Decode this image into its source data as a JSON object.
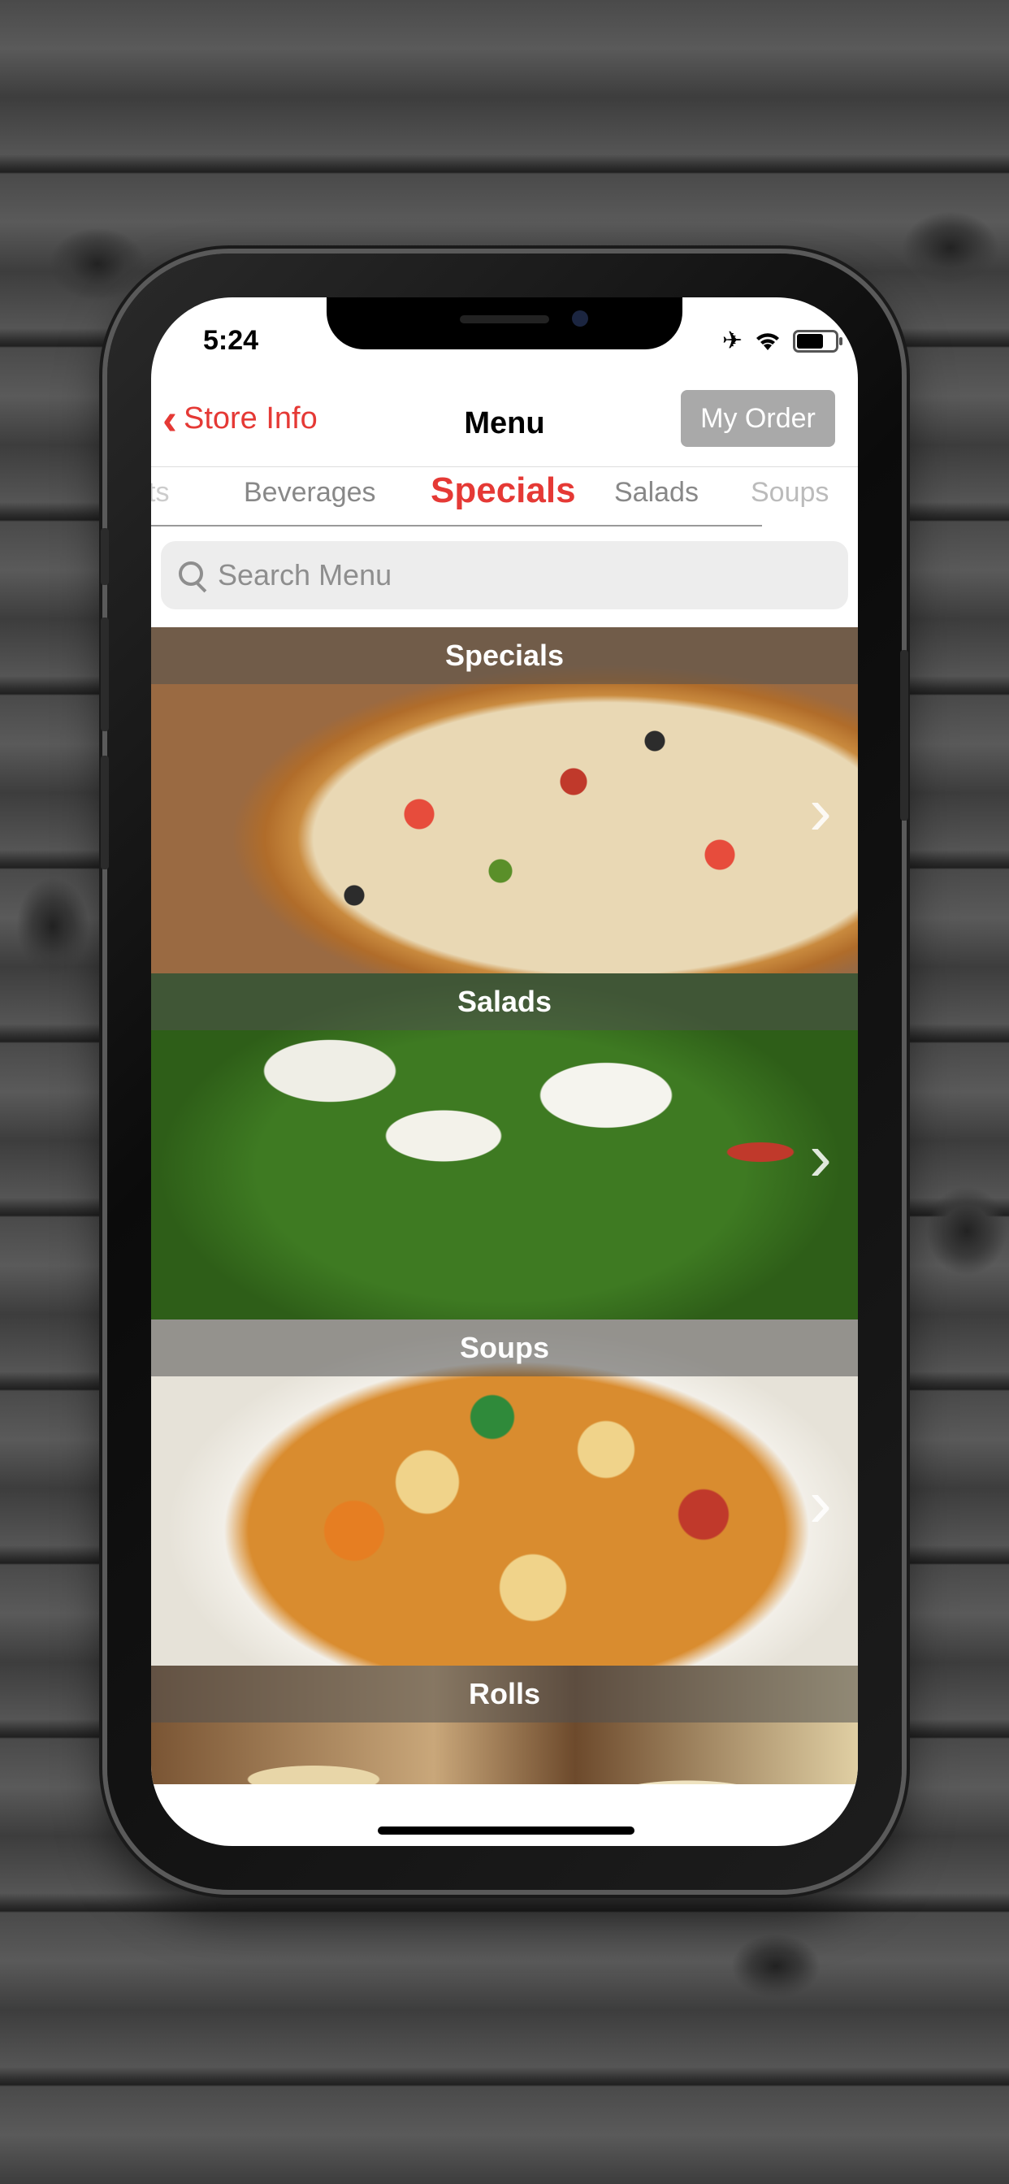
{
  "status_bar": {
    "time": "5:24",
    "icons": [
      "airplane-icon",
      "wifi-icon",
      "battery-icon"
    ],
    "battery_level": 0.7
  },
  "navbar": {
    "back_label": "Store Info",
    "title": "Menu",
    "order_button": "My Order",
    "accent_color": "#e53935"
  },
  "tabs": [
    {
      "label": "ts"
    },
    {
      "label": "Beverages"
    },
    {
      "label": "Specials",
      "active": true
    },
    {
      "label": "Salads"
    },
    {
      "label": "Soups"
    }
  ],
  "search": {
    "placeholder": "Search Menu"
  },
  "categories": [
    {
      "title": "Specials"
    },
    {
      "title": "Salads"
    },
    {
      "title": "Soups"
    },
    {
      "title": "Rolls"
    }
  ]
}
